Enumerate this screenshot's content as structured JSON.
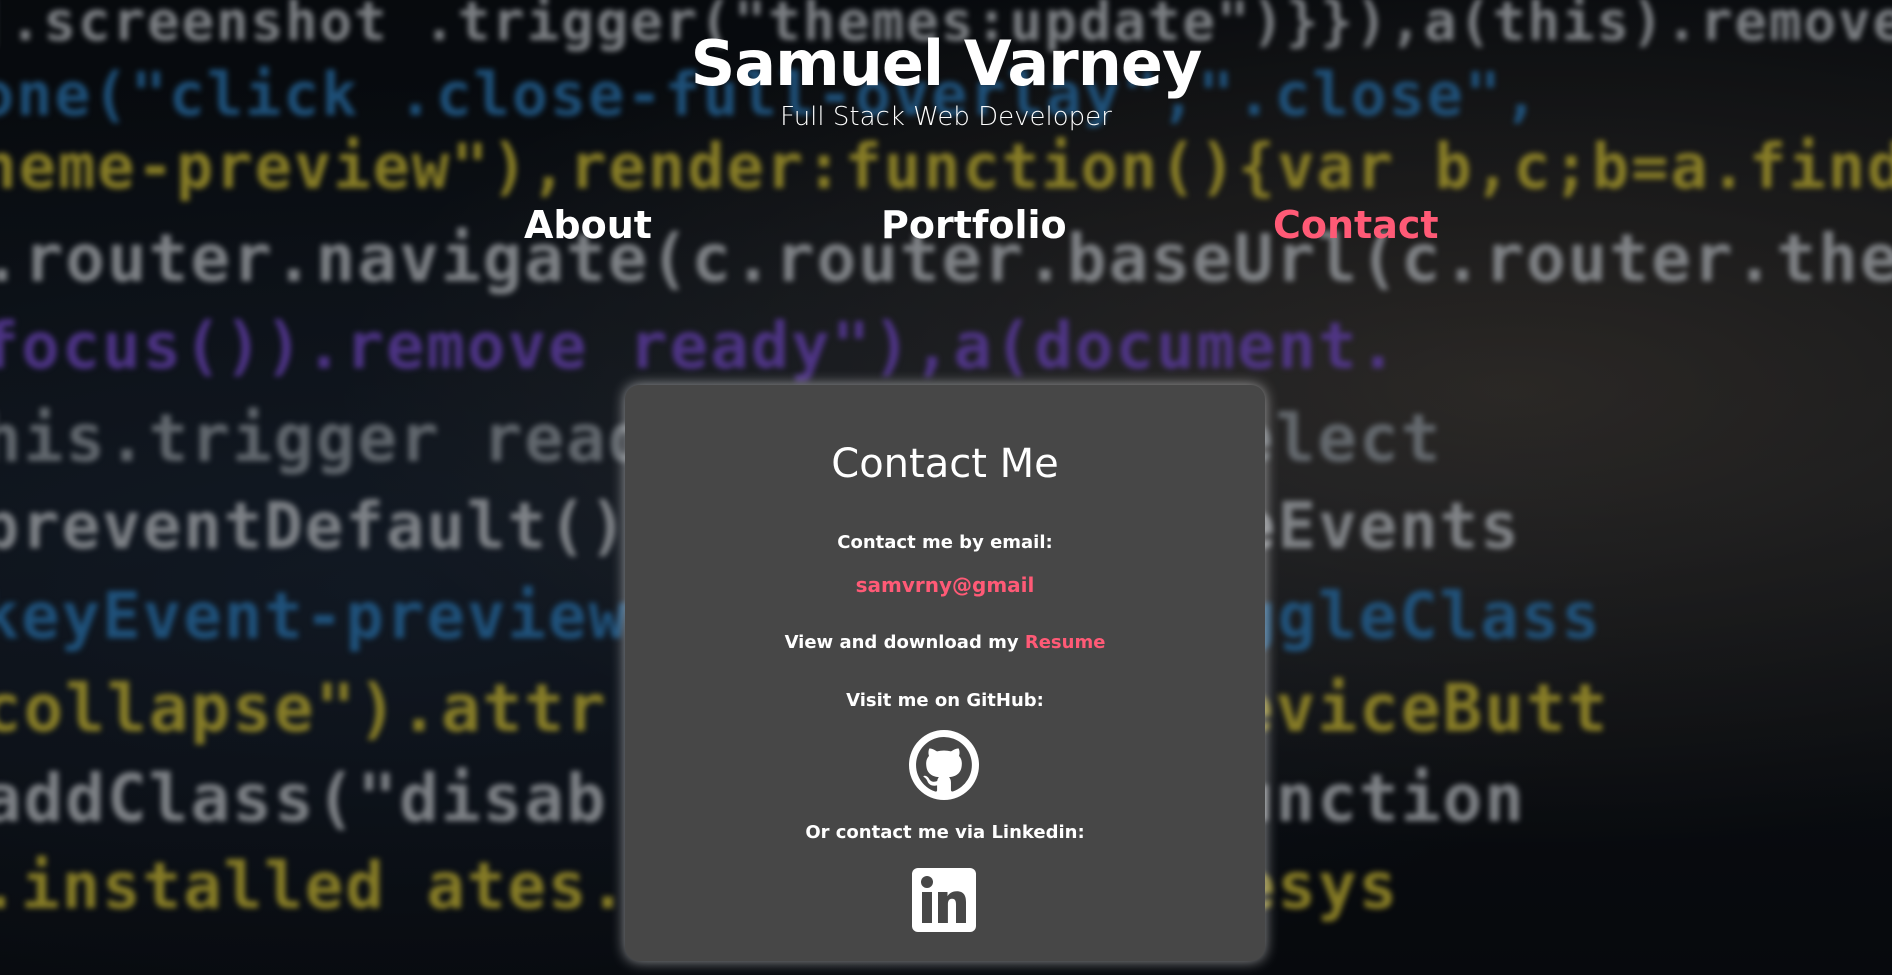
{
  "header": {
    "title": "Samuel Varney",
    "subtitle": "Full Stack Web Developer"
  },
  "nav": {
    "about": "About",
    "portfolio": "Portfolio",
    "contact": "Contact"
  },
  "contact": {
    "heading": "Contact Me",
    "email_label": "Contact me by email:",
    "email": "samvrny@gmail",
    "resume_prefix": "View and download my ",
    "resume_link": "Resume",
    "github_label": "Visit me on GitHub:",
    "linkedin_label": "Or contact me via Linkedin:"
  },
  "icons": {
    "github": "github-icon",
    "linkedin": "linkedin-icon"
  },
  "colors": {
    "accent": "#ff5a76",
    "card_background": "#474747",
    "text": "#ffffff"
  }
}
